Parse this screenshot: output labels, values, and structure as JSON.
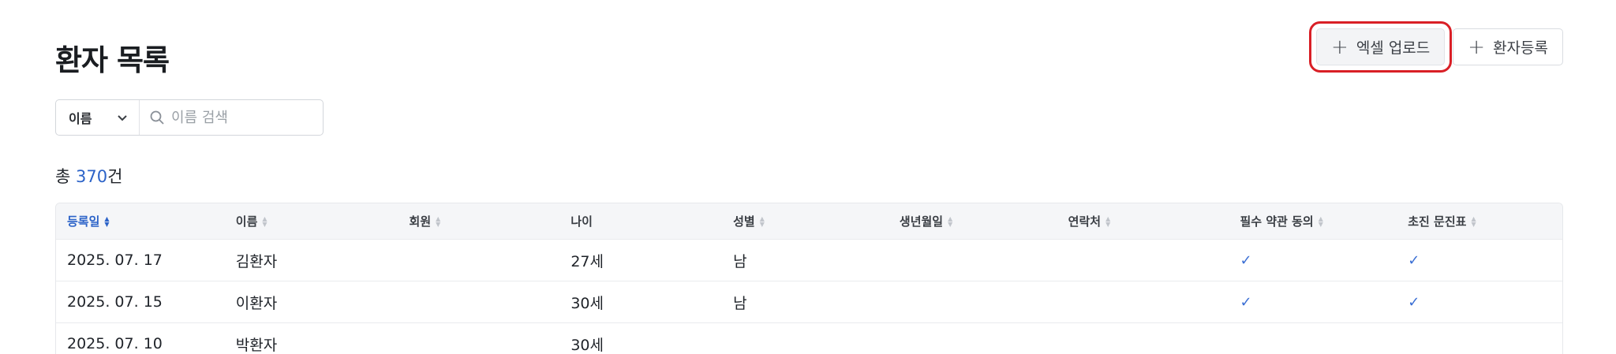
{
  "header": {
    "title": "환자 목록",
    "upload_button": "엑셀 업로드",
    "register_button": "환자등록"
  },
  "search": {
    "field_selected": "이름",
    "placeholder": "이름 검색"
  },
  "summary": {
    "prefix": "총",
    "count": "370",
    "suffix": "건"
  },
  "table": {
    "columns": [
      "등록일",
      "이름",
      "회원",
      "나이",
      "성별",
      "생년월일",
      "연락처",
      "필수 약관 동의",
      "초진 문진표"
    ],
    "rows": [
      {
        "date": "2025. 07. 17",
        "name": "김환자",
        "member": "",
        "age": "27세",
        "gender": "남",
        "birth": "",
        "phone": "",
        "terms": "✓",
        "questionnaire": "✓"
      },
      {
        "date": "2025. 07. 15",
        "name": "이환자",
        "member": "",
        "age": "30세",
        "gender": "남",
        "birth": "",
        "phone": "",
        "terms": "✓",
        "questionnaire": "✓"
      },
      {
        "date": "2025. 07. 10",
        "name": "박환자",
        "member": "",
        "age": "30세",
        "gender": "",
        "birth": "",
        "phone": "",
        "terms": "",
        "questionnaire": ""
      }
    ]
  },
  "colors": {
    "accent": "#2c63c8",
    "highlight_border": "#d91f26"
  },
  "icons": {
    "plus": "plus-icon",
    "search": "search-icon",
    "dropdown": "chevron-down-icon",
    "sort": "sort-icon",
    "check": "check-icon"
  }
}
